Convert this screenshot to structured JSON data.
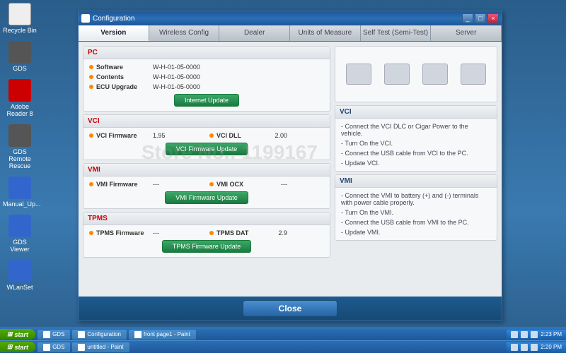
{
  "desktop": {
    "icons": [
      "Recycle Bin",
      "GDS",
      "Adobe Reader 8",
      "GDS Remote Rescue",
      "Manual_Up...",
      "GDS Viewer",
      "WLanSet"
    ]
  },
  "window": {
    "title": "Configuration",
    "tabs": [
      "Version",
      "Wireless Config",
      "Dealer",
      "Units of Measure",
      "Self Test (Semi-Test)",
      "Server"
    ],
    "active_tab": 0,
    "close_label": "Close"
  },
  "pc": {
    "header": "PC",
    "rows": [
      {
        "label": "Software",
        "value": "W-H-01-05-0000"
      },
      {
        "label": "Contents",
        "value": "W-H-01-05-0000"
      },
      {
        "label": "ECU Upgrade",
        "value": "W-H-01-05-0000"
      }
    ],
    "button": "Internet Update"
  },
  "vci": {
    "header": "VCI",
    "fw_label": "VCI Firmware",
    "fw_value": "1.95",
    "dll_label": "VCI DLL",
    "dll_value": "2.00",
    "button": "VCI Firmware Update"
  },
  "vmi": {
    "header": "VMI",
    "fw_label": "VMI Firmware",
    "fw_value": "---",
    "ocx_label": "VMI OCX",
    "ocx_value": "---",
    "button": "VMI Firmware Update"
  },
  "tpms": {
    "header": "TPMS",
    "fw_label": "TPMS Firmware",
    "fw_value": "---",
    "dat_label": "TPMS DAT",
    "dat_value": "2.9",
    "button": "TPMS Firmware Update"
  },
  "info_vci": {
    "header": "VCI",
    "items": [
      "Connect the VCI DLC or Cigar Power to the vehicle.",
      "Turn On the VCI.",
      "Connect the USB cable from VCI to the PC.",
      "Update VCI."
    ]
  },
  "info_vmi": {
    "header": "VMI",
    "items": [
      "Connect the VMI to battery (+) and (-) terminals with power cable properly.",
      "Turn On the VMI.",
      "Connect the USB cable from VMI to the PC.",
      "Update VMI."
    ]
  },
  "taskbar": {
    "start": "start",
    "items1": [
      "GDS",
      "Configuration",
      "front page1 - Paint"
    ],
    "items2": [
      "GDS",
      "untitled - Paint"
    ],
    "time1": "2:23 PM",
    "time2": "2:20 PM"
  },
  "watermark": "Store No.: 1199167"
}
